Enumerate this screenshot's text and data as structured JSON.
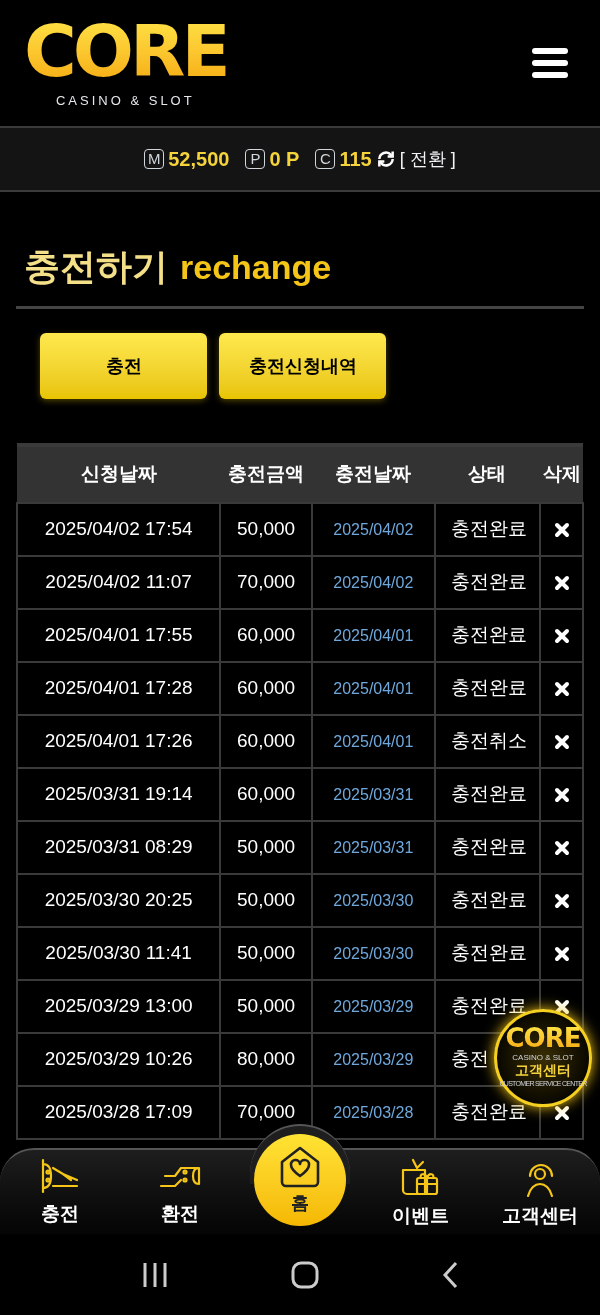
{
  "logo": {
    "wordmark": "CORE",
    "tagline": "CASINO & SLOT"
  },
  "balance": [
    {
      "badge": "M",
      "value": "52,500"
    },
    {
      "badge": "P",
      "value": "0 P"
    },
    {
      "badge": "C",
      "value": "115"
    }
  ],
  "convert": "[ 전환 ]",
  "title": {
    "main": "충전하기",
    "sub": "rechange"
  },
  "buttons": [
    "충전",
    "충전신청내역"
  ],
  "table": {
    "columns": [
      "신청날짜",
      "충전금액",
      "충전날짜",
      "상태",
      "삭제"
    ],
    "rows": [
      {
        "requested": "2025/04/02 17:54",
        "amount": "50,000",
        "charged": "2025/04/02",
        "status": "충전완료"
      },
      {
        "requested": "2025/04/02 11:07",
        "amount": "70,000",
        "charged": "2025/04/02",
        "status": "충전완료"
      },
      {
        "requested": "2025/04/01 17:55",
        "amount": "60,000",
        "charged": "2025/04/01",
        "status": "충전완료"
      },
      {
        "requested": "2025/04/01 17:28",
        "amount": "60,000",
        "charged": "2025/04/01",
        "status": "충전완료"
      },
      {
        "requested": "2025/04/01 17:26",
        "amount": "60,000",
        "charged": "2025/04/01",
        "status": "충전취소"
      },
      {
        "requested": "2025/03/31 19:14",
        "amount": "60,000",
        "charged": "2025/03/31",
        "status": "충전완료"
      },
      {
        "requested": "2025/03/31 08:29",
        "amount": "50,000",
        "charged": "2025/03/31",
        "status": "충전완료"
      },
      {
        "requested": "2025/03/30 20:25",
        "amount": "50,000",
        "charged": "2025/03/30",
        "status": "충전완료"
      },
      {
        "requested": "2025/03/30 11:41",
        "amount": "50,000",
        "charged": "2025/03/30",
        "status": "충전완료"
      },
      {
        "requested": "2025/03/29 13:00",
        "amount": "50,000",
        "charged": "2025/03/29",
        "status": "충전완료"
      },
      {
        "requested": "2025/03/29 10:26",
        "amount": "80,000",
        "charged": "2025/03/29",
        "status": "충전",
        "delete_icon": false
      },
      {
        "requested": "2025/03/28 17:09",
        "amount": "70,000",
        "charged": "2025/03/28",
        "status": "충전완료"
      }
    ]
  },
  "support_badge": {
    "wordmark": "CORE",
    "tagline": "CASINO & SLOT",
    "label": "고객센터",
    "caption": "CUSTOMER SERVICE CENTER"
  },
  "bottom_nav": [
    {
      "kind": "charge",
      "label": "충전"
    },
    {
      "kind": "exchange",
      "label": "환전"
    },
    {
      "kind": "home",
      "label": "홈"
    },
    {
      "kind": "event",
      "label": "이벤트"
    },
    {
      "kind": "support",
      "label": "고객센터"
    }
  ]
}
